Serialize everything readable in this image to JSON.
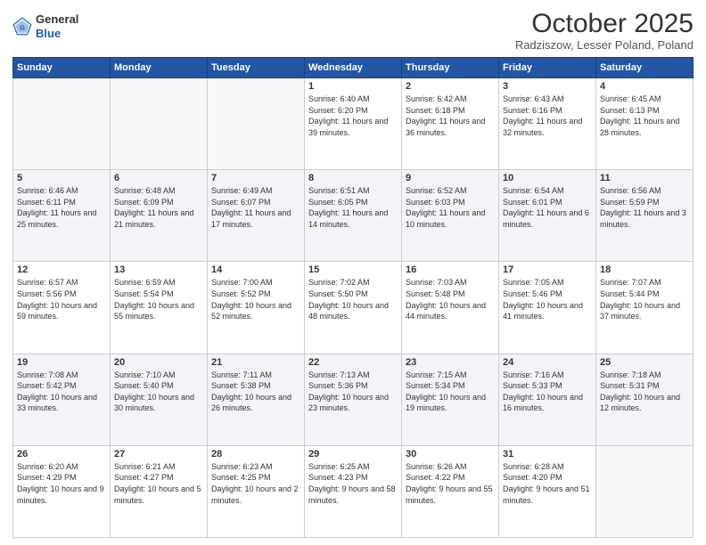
{
  "header": {
    "logo_general": "General",
    "logo_blue": "Blue",
    "month": "October 2025",
    "location": "Radziszow, Lesser Poland, Poland"
  },
  "weekdays": [
    "Sunday",
    "Monday",
    "Tuesday",
    "Wednesday",
    "Thursday",
    "Friday",
    "Saturday"
  ],
  "weeks": [
    [
      {
        "day": "",
        "sunrise": "",
        "sunset": "",
        "daylight": ""
      },
      {
        "day": "",
        "sunrise": "",
        "sunset": "",
        "daylight": ""
      },
      {
        "day": "",
        "sunrise": "",
        "sunset": "",
        "daylight": ""
      },
      {
        "day": "1",
        "sunrise": "Sunrise: 6:40 AM",
        "sunset": "Sunset: 6:20 PM",
        "daylight": "Daylight: 11 hours and 39 minutes."
      },
      {
        "day": "2",
        "sunrise": "Sunrise: 6:42 AM",
        "sunset": "Sunset: 6:18 PM",
        "daylight": "Daylight: 11 hours and 36 minutes."
      },
      {
        "day": "3",
        "sunrise": "Sunrise: 6:43 AM",
        "sunset": "Sunset: 6:16 PM",
        "daylight": "Daylight: 11 hours and 32 minutes."
      },
      {
        "day": "4",
        "sunrise": "Sunrise: 6:45 AM",
        "sunset": "Sunset: 6:13 PM",
        "daylight": "Daylight: 11 hours and 28 minutes."
      }
    ],
    [
      {
        "day": "5",
        "sunrise": "Sunrise: 6:46 AM",
        "sunset": "Sunset: 6:11 PM",
        "daylight": "Daylight: 11 hours and 25 minutes."
      },
      {
        "day": "6",
        "sunrise": "Sunrise: 6:48 AM",
        "sunset": "Sunset: 6:09 PM",
        "daylight": "Daylight: 11 hours and 21 minutes."
      },
      {
        "day": "7",
        "sunrise": "Sunrise: 6:49 AM",
        "sunset": "Sunset: 6:07 PM",
        "daylight": "Daylight: 11 hours and 17 minutes."
      },
      {
        "day": "8",
        "sunrise": "Sunrise: 6:51 AM",
        "sunset": "Sunset: 6:05 PM",
        "daylight": "Daylight: 11 hours and 14 minutes."
      },
      {
        "day": "9",
        "sunrise": "Sunrise: 6:52 AM",
        "sunset": "Sunset: 6:03 PM",
        "daylight": "Daylight: 11 hours and 10 minutes."
      },
      {
        "day": "10",
        "sunrise": "Sunrise: 6:54 AM",
        "sunset": "Sunset: 6:01 PM",
        "daylight": "Daylight: 11 hours and 6 minutes."
      },
      {
        "day": "11",
        "sunrise": "Sunrise: 6:56 AM",
        "sunset": "Sunset: 5:59 PM",
        "daylight": "Daylight: 11 hours and 3 minutes."
      }
    ],
    [
      {
        "day": "12",
        "sunrise": "Sunrise: 6:57 AM",
        "sunset": "Sunset: 5:56 PM",
        "daylight": "Daylight: 10 hours and 59 minutes."
      },
      {
        "day": "13",
        "sunrise": "Sunrise: 6:59 AM",
        "sunset": "Sunset: 5:54 PM",
        "daylight": "Daylight: 10 hours and 55 minutes."
      },
      {
        "day": "14",
        "sunrise": "Sunrise: 7:00 AM",
        "sunset": "Sunset: 5:52 PM",
        "daylight": "Daylight: 10 hours and 52 minutes."
      },
      {
        "day": "15",
        "sunrise": "Sunrise: 7:02 AM",
        "sunset": "Sunset: 5:50 PM",
        "daylight": "Daylight: 10 hours and 48 minutes."
      },
      {
        "day": "16",
        "sunrise": "Sunrise: 7:03 AM",
        "sunset": "Sunset: 5:48 PM",
        "daylight": "Daylight: 10 hours and 44 minutes."
      },
      {
        "day": "17",
        "sunrise": "Sunrise: 7:05 AM",
        "sunset": "Sunset: 5:46 PM",
        "daylight": "Daylight: 10 hours and 41 minutes."
      },
      {
        "day": "18",
        "sunrise": "Sunrise: 7:07 AM",
        "sunset": "Sunset: 5:44 PM",
        "daylight": "Daylight: 10 hours and 37 minutes."
      }
    ],
    [
      {
        "day": "19",
        "sunrise": "Sunrise: 7:08 AM",
        "sunset": "Sunset: 5:42 PM",
        "daylight": "Daylight: 10 hours and 33 minutes."
      },
      {
        "day": "20",
        "sunrise": "Sunrise: 7:10 AM",
        "sunset": "Sunset: 5:40 PM",
        "daylight": "Daylight: 10 hours and 30 minutes."
      },
      {
        "day": "21",
        "sunrise": "Sunrise: 7:11 AM",
        "sunset": "Sunset: 5:38 PM",
        "daylight": "Daylight: 10 hours and 26 minutes."
      },
      {
        "day": "22",
        "sunrise": "Sunrise: 7:13 AM",
        "sunset": "Sunset: 5:36 PM",
        "daylight": "Daylight: 10 hours and 23 minutes."
      },
      {
        "day": "23",
        "sunrise": "Sunrise: 7:15 AM",
        "sunset": "Sunset: 5:34 PM",
        "daylight": "Daylight: 10 hours and 19 minutes."
      },
      {
        "day": "24",
        "sunrise": "Sunrise: 7:16 AM",
        "sunset": "Sunset: 5:33 PM",
        "daylight": "Daylight: 10 hours and 16 minutes."
      },
      {
        "day": "25",
        "sunrise": "Sunrise: 7:18 AM",
        "sunset": "Sunset: 5:31 PM",
        "daylight": "Daylight: 10 hours and 12 minutes."
      }
    ],
    [
      {
        "day": "26",
        "sunrise": "Sunrise: 6:20 AM",
        "sunset": "Sunset: 4:29 PM",
        "daylight": "Daylight: 10 hours and 9 minutes."
      },
      {
        "day": "27",
        "sunrise": "Sunrise: 6:21 AM",
        "sunset": "Sunset: 4:27 PM",
        "daylight": "Daylight: 10 hours and 5 minutes."
      },
      {
        "day": "28",
        "sunrise": "Sunrise: 6:23 AM",
        "sunset": "Sunset: 4:25 PM",
        "daylight": "Daylight: 10 hours and 2 minutes."
      },
      {
        "day": "29",
        "sunrise": "Sunrise: 6:25 AM",
        "sunset": "Sunset: 4:23 PM",
        "daylight": "Daylight: 9 hours and 58 minutes."
      },
      {
        "day": "30",
        "sunrise": "Sunrise: 6:26 AM",
        "sunset": "Sunset: 4:22 PM",
        "daylight": "Daylight: 9 hours and 55 minutes."
      },
      {
        "day": "31",
        "sunrise": "Sunrise: 6:28 AM",
        "sunset": "Sunset: 4:20 PM",
        "daylight": "Daylight: 9 hours and 51 minutes."
      },
      {
        "day": "",
        "sunrise": "",
        "sunset": "",
        "daylight": ""
      }
    ]
  ]
}
